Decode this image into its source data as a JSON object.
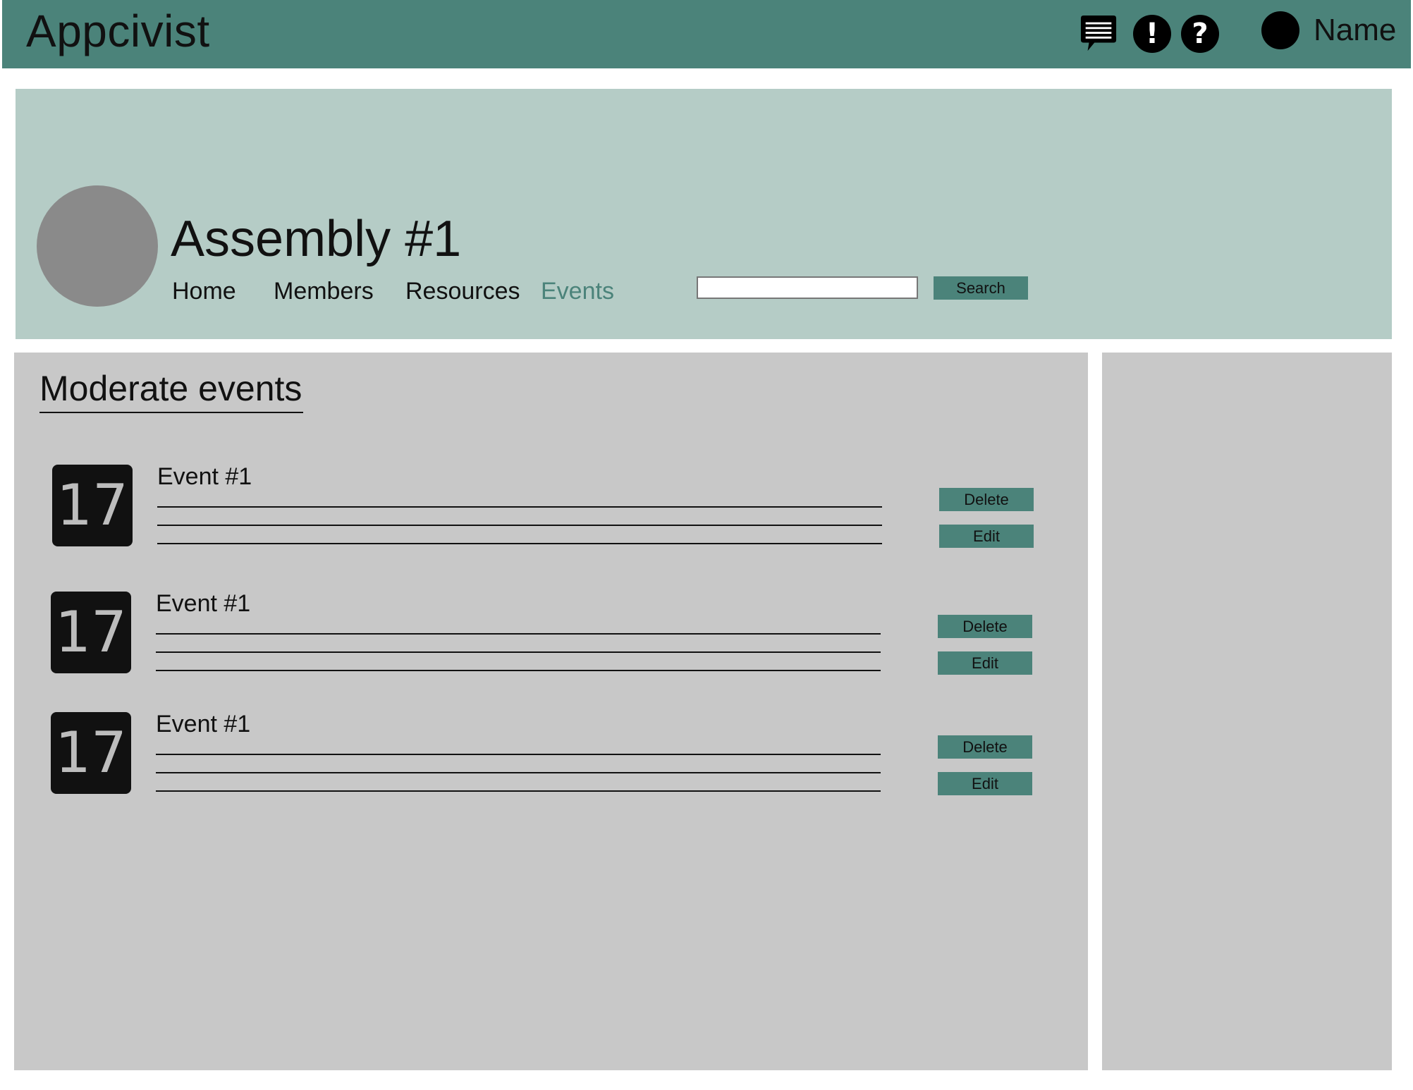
{
  "app": {
    "title": "Appcivist",
    "user_name": "Name",
    "icons": [
      "chat-bubble-icon",
      "alert-icon",
      "help-icon"
    ],
    "alert_glyph": "!",
    "help_glyph": "?"
  },
  "colors": {
    "brand": "#4b837a",
    "header_panel": "#b5ccc6",
    "content_panel": "#c8c8c8",
    "date_badge": "#111111"
  },
  "assembly": {
    "title": "Assembly #1",
    "nav": [
      "Home",
      "Members",
      "Resources",
      "Events"
    ],
    "active_nav": "Events",
    "search": {
      "value": "",
      "placeholder": "",
      "button_label": "Search"
    }
  },
  "main": {
    "section_title": "Moderate events",
    "events": [
      {
        "date": "17",
        "title": "Event #1",
        "delete_label": "Delete",
        "edit_label": "Edit"
      },
      {
        "date": "17",
        "title": "Event #1",
        "delete_label": "Delete",
        "edit_label": "Edit"
      },
      {
        "date": "17",
        "title": "Event #1",
        "delete_label": "Delete",
        "edit_label": "Edit"
      }
    ]
  }
}
